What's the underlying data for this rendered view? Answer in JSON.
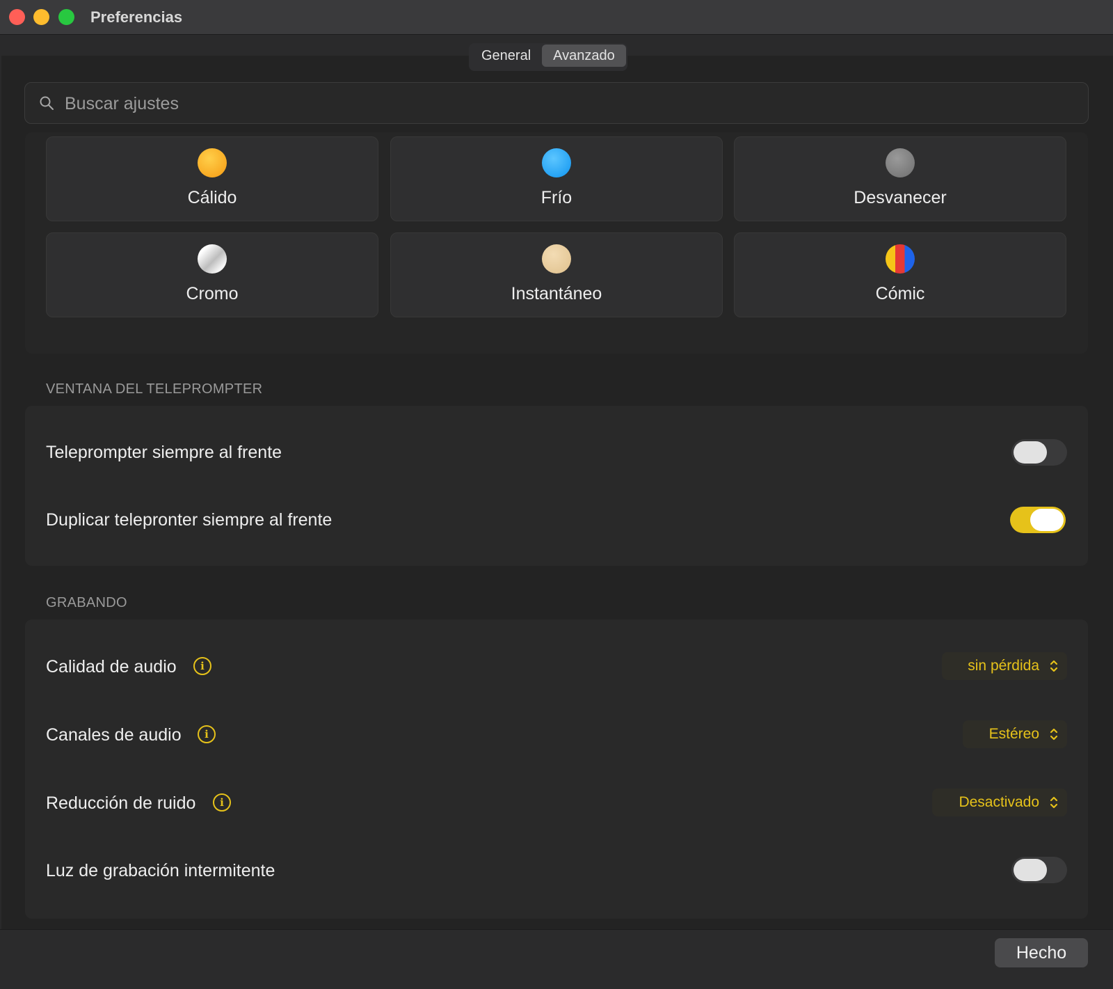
{
  "window": {
    "title": "Preferencias"
  },
  "tabs": [
    {
      "label": "General",
      "active": false
    },
    {
      "label": "Avanzado",
      "active": true
    }
  ],
  "search": {
    "placeholder": "Buscar ajustes",
    "value": ""
  },
  "filters": [
    {
      "label": "Cálido",
      "icon": "warm-dot-icon",
      "color": "#f7a51c"
    },
    {
      "label": "Frío",
      "icon": "cool-dot-icon",
      "color": "#1aa0f5"
    },
    {
      "label": "Desvanecer",
      "icon": "fade-dot-icon",
      "color": "#7a7a7a"
    },
    {
      "label": "Cromo",
      "icon": "chrome-dot-icon",
      "color": "#e8e8e8"
    },
    {
      "label": "Instantáneo",
      "icon": "instant-dot-icon",
      "color": "#e9cfa0"
    },
    {
      "label": "Cómic",
      "icon": "comic-dot-icon",
      "color": "#e53935"
    }
  ],
  "teleprompter": {
    "title": "VENTANA DEL TELEPROMPTER",
    "rows": [
      {
        "label": "Teleprompter siempre al frente",
        "on": false
      },
      {
        "label": "Duplicar telepronter siempre al frente",
        "on": true
      }
    ]
  },
  "recording": {
    "title": "GRABANDO",
    "audio_quality": {
      "label": "Calidad de audio",
      "value": "sin pérdida"
    },
    "audio_channels": {
      "label": "Canales de audio",
      "value": "Estéreo"
    },
    "noise_reduction": {
      "label": "Reducción de ruido",
      "value": "Desactivado"
    },
    "blink_light": {
      "label": "Luz de grabación intermitente",
      "on": false
    }
  },
  "footer": {
    "done_label": "Hecho"
  },
  "colors": {
    "accent": "#e6c21a",
    "background": "#232323"
  }
}
